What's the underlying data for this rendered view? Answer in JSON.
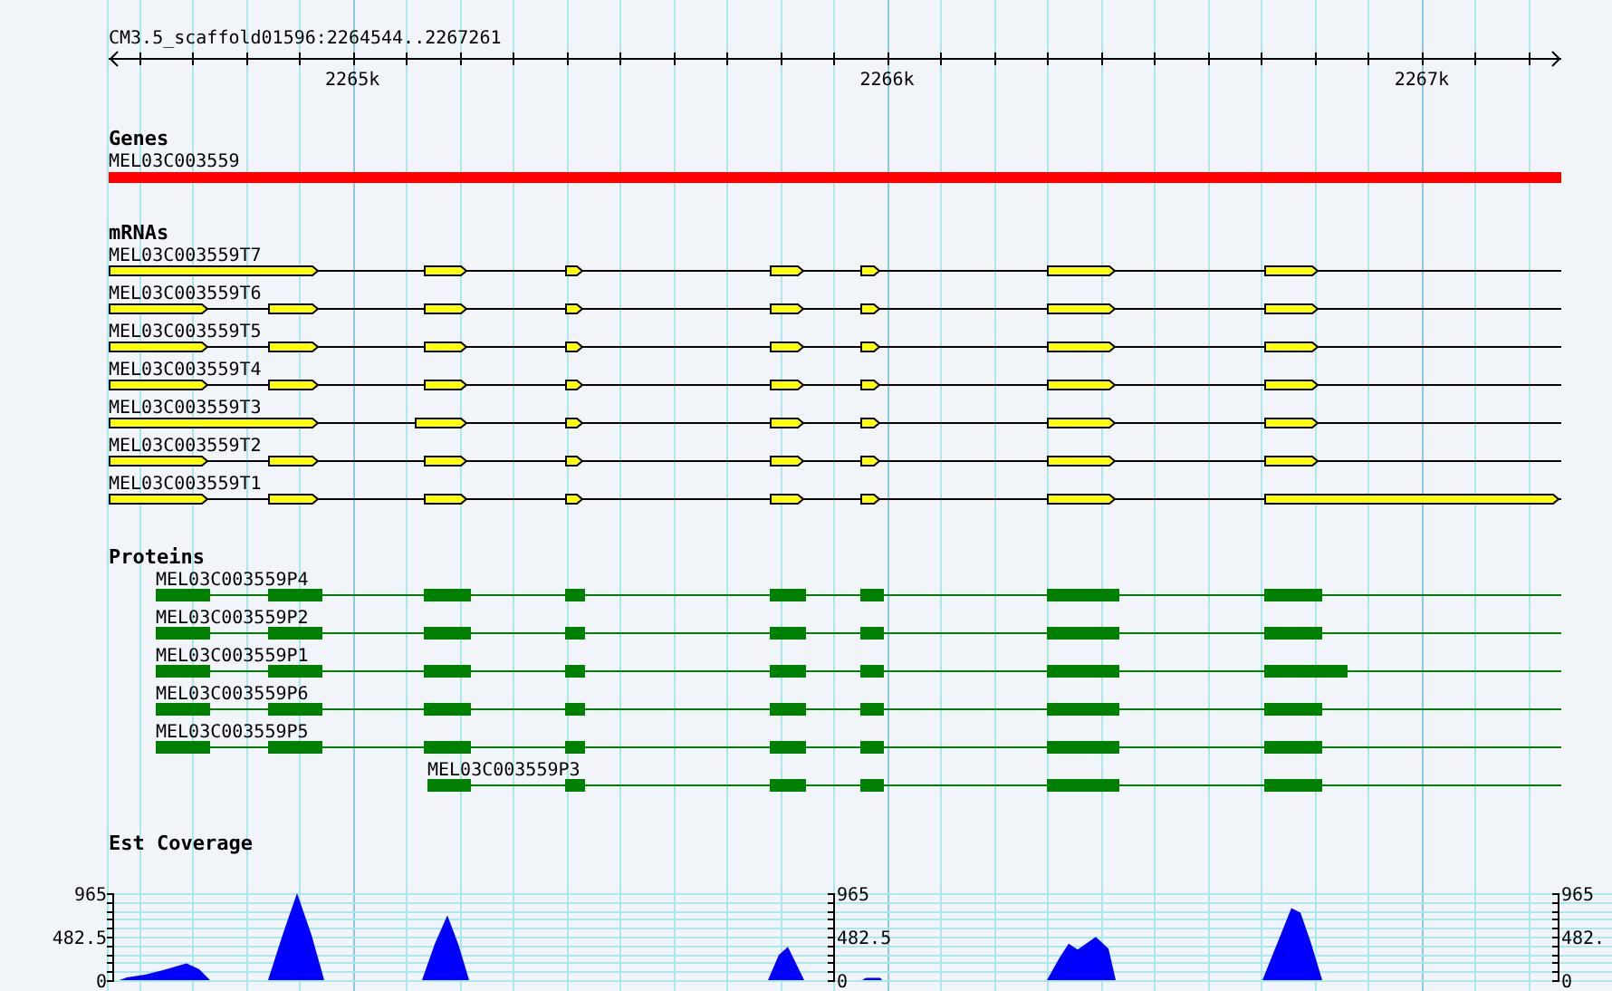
{
  "ruler": {
    "title": "CM3.5_scaffold01596:2264544..2267261",
    "labels": [
      "2265k",
      "2266k",
      "2267k"
    ]
  },
  "tracks": [
    {
      "kind": "genes",
      "title": "Genes",
      "features": [
        {
          "name": "MEL03C003559"
        }
      ]
    },
    {
      "kind": "mrnas",
      "title": "mRNAs",
      "features": [
        {
          "name": "MEL03C003559T7"
        },
        {
          "name": "MEL03C003559T6"
        },
        {
          "name": "MEL03C003559T5"
        },
        {
          "name": "MEL03C003559T4"
        },
        {
          "name": "MEL03C003559T3"
        },
        {
          "name": "MEL03C003559T2"
        },
        {
          "name": "MEL03C003559T1"
        }
      ]
    },
    {
      "kind": "proteins",
      "title": "Proteins",
      "features": [
        {
          "name": "MEL03C003559P4"
        },
        {
          "name": "MEL03C003559P2"
        },
        {
          "name": "MEL03C003559P1"
        },
        {
          "name": "MEL03C003559P6"
        },
        {
          "name": "MEL03C003559P5"
        },
        {
          "name": "MEL03C003559P3"
        }
      ]
    },
    {
      "kind": "coverage",
      "title": "Est Coverage",
      "axes": [
        {
          "labels": [
            "965",
            "482.5",
            "0"
          ]
        },
        {
          "labels": [
            "965",
            "482.5",
            "0"
          ]
        },
        {
          "labels": [
            "965",
            "482.",
            "0"
          ]
        }
      ]
    }
  ]
}
